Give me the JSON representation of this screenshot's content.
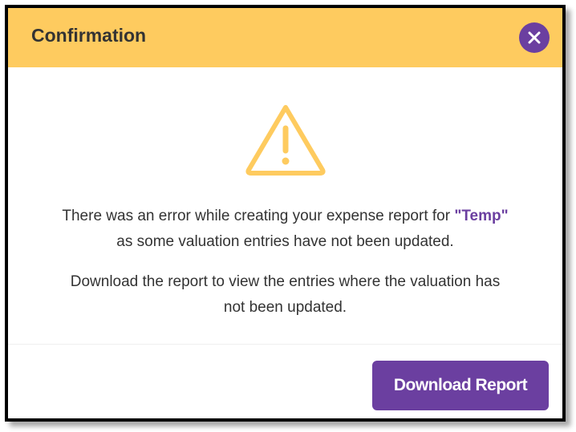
{
  "dialog": {
    "title": "Confirmation",
    "close_icon": "close-icon",
    "warning_icon": "warning-triangle-icon",
    "message_line1_pre": "There was an error while creating your expense report for ",
    "report_name": "\"Temp\"",
    "message_line1_post": "as some valuation entries have not been updated.",
    "message_line2a": "Download the report to view the entries where the valuation has",
    "message_line2b": "not been updated.",
    "download_label": "Download Report"
  },
  "colors": {
    "header_bg": "#fecb5f",
    "accent": "#6b3fa0",
    "warning": "#fecb5f"
  }
}
